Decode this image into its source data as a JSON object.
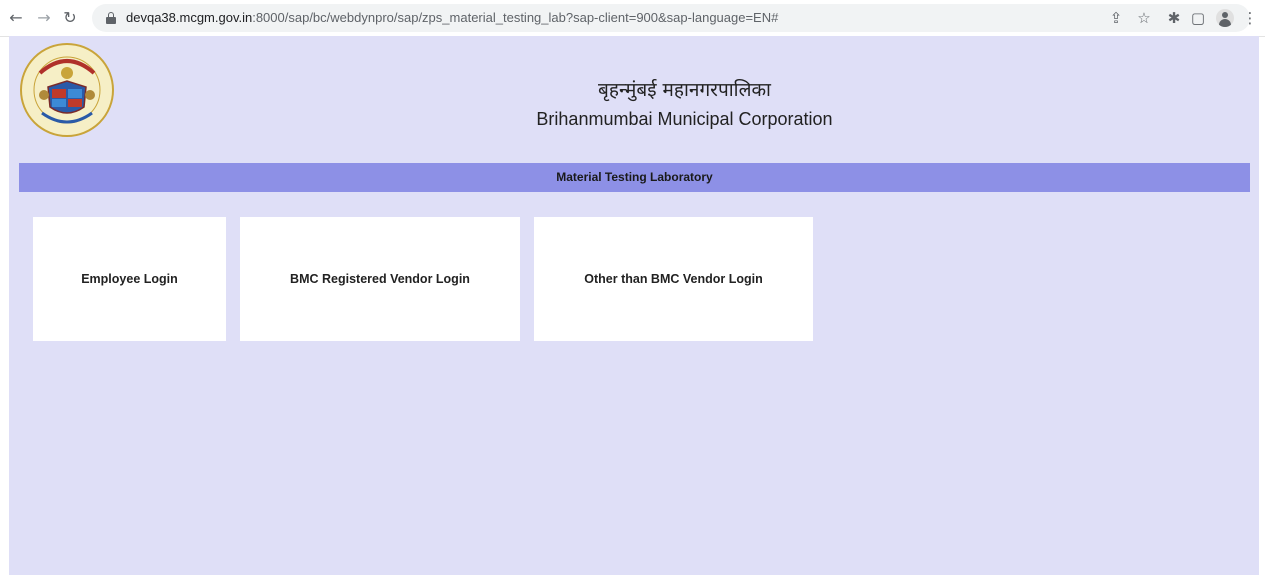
{
  "browser": {
    "url_host": "devqa38.mcgm.gov.in",
    "url_rest": ":8000/sap/bc/webdynpro/sap/zps_material_testing_lab?sap-client=900&sap-language=EN#",
    "back_icon": "back-arrow-icon",
    "forward_icon": "forward-arrow-icon",
    "reload_icon": "reload-icon",
    "toolbar_icons": [
      "share-icon",
      "star-icon",
      "extensions-icon",
      "sidepanel-icon",
      "profile-icon",
      "menu-icon"
    ]
  },
  "header": {
    "title_hindi": "बृहन्मुंबई महानगरपालिका",
    "title_english": "Brihanmumbai Municipal Corporation"
  },
  "banner": {
    "title": "Material Testing Laboratory"
  },
  "tiles": [
    {
      "label": "Employee Login"
    },
    {
      "label": "BMC Registered Vendor Login"
    },
    {
      "label": "Other than BMC Vendor Login"
    }
  ],
  "colors": {
    "page_bg": "#dfdff7",
    "banner_bg": "#8d90e6",
    "tile_bg": "#ffffff"
  }
}
